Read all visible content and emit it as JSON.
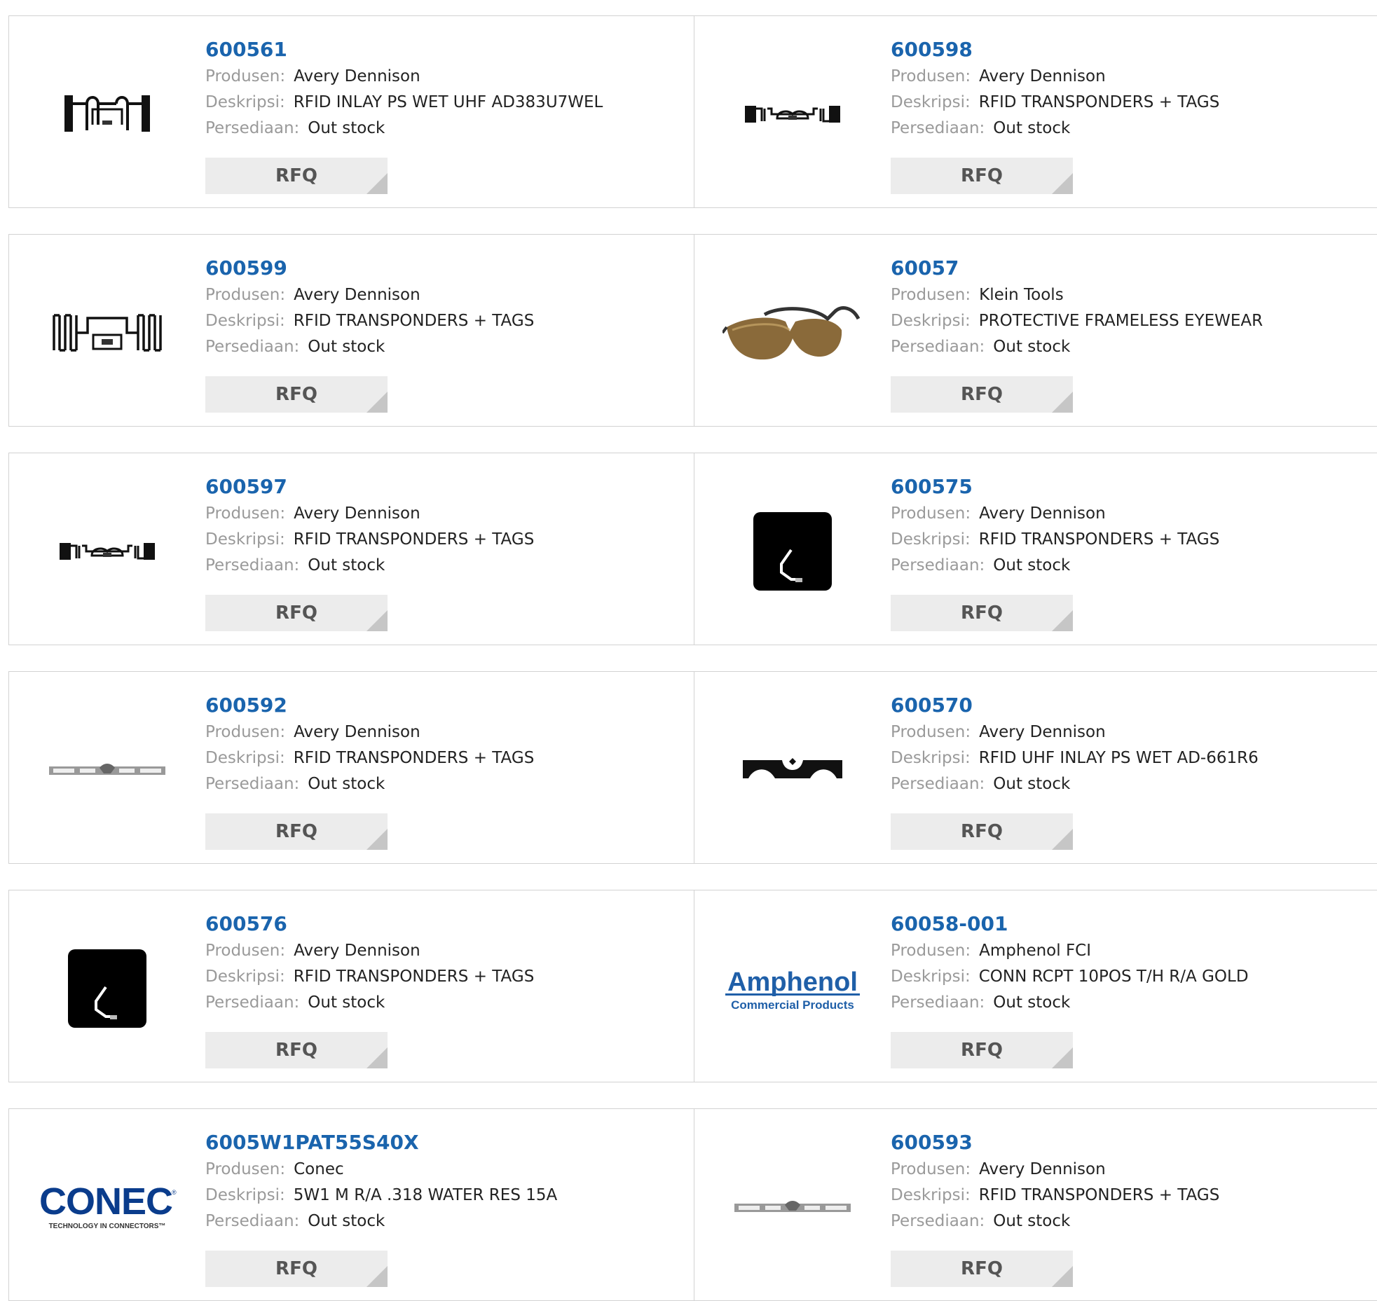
{
  "labels": {
    "manufacturer": "Produsen:",
    "description": "Deskripsi:",
    "stock": "Persediaan:",
    "rfq": "RFQ"
  },
  "products": [
    {
      "part": "600561",
      "manufacturer": "Avery Dennison",
      "description": "RFID INLAY PS WET UHF AD383U7WEL",
      "stock": "Out stock",
      "image": "rfid-inlay-antenna-icon"
    },
    {
      "part": "600598",
      "manufacturer": "Avery Dennison",
      "description": "RFID TRANSPONDERS + TAGS",
      "stock": "Out stock",
      "image": "rfid-strip-antenna-icon"
    },
    {
      "part": "600599",
      "manufacturer": "Avery Dennison",
      "description": "RFID TRANSPONDERS + TAGS",
      "stock": "Out stock",
      "image": "rfid-zigzag-antenna-icon"
    },
    {
      "part": "60057",
      "manufacturer": "Klein Tools",
      "description": "PROTECTIVE FRAMELESS EYEWEAR",
      "stock": "Out stock",
      "image": "safety-glasses-icon"
    },
    {
      "part": "600597",
      "manufacturer": "Avery Dennison",
      "description": "RFID TRANSPONDERS + TAGS",
      "stock": "Out stock",
      "image": "rfid-strip-antenna-icon"
    },
    {
      "part": "600575",
      "manufacturer": "Avery Dennison",
      "description": "RFID TRANSPONDERS + TAGS",
      "stock": "Out stock",
      "image": "rfid-square-tag-icon"
    },
    {
      "part": "600592",
      "manufacturer": "Avery Dennison",
      "description": "RFID TRANSPONDERS + TAGS",
      "stock": "Out stock",
      "image": "rfid-thin-strip-icon"
    },
    {
      "part": "600570",
      "manufacturer": "Avery Dennison",
      "description": "RFID UHF INLAY PS WET AD-661R6",
      "stock": "Out stock",
      "image": "rfid-arch-inlay-icon"
    },
    {
      "part": "600576",
      "manufacturer": "Avery Dennison",
      "description": "RFID TRANSPONDERS + TAGS",
      "stock": "Out stock",
      "image": "rfid-square-tag-icon"
    },
    {
      "part": "60058-001",
      "manufacturer": "Amphenol FCI",
      "description": "CONN RCPT 10POS T/H R/A GOLD",
      "stock": "Out stock",
      "image": "amphenol-logo",
      "logo_text": "Amphenol",
      "logo_sub": "Commercial Products"
    },
    {
      "part": "6005W1PAT55S40X",
      "manufacturer": "Conec",
      "description": "5W1 M R/A .318 WATER RES 15A",
      "stock": "Out stock",
      "image": "conec-logo",
      "logo_text": "CONEC",
      "logo_sub": "TECHNOLOGY IN CONNECTORS"
    },
    {
      "part": "600593",
      "manufacturer": "Avery Dennison",
      "description": "RFID TRANSPONDERS + TAGS",
      "stock": "Out stock",
      "image": "rfid-thin-strip-icon"
    }
  ],
  "colors": {
    "part_link": "#1a64ad",
    "label_gray": "#9a9a9a",
    "rfq_bg": "#ececec",
    "amphenol_blue": "#1f5fa8",
    "conec_blue": "#0a3c8c",
    "eyewear_lens": "#8a6a3a"
  }
}
